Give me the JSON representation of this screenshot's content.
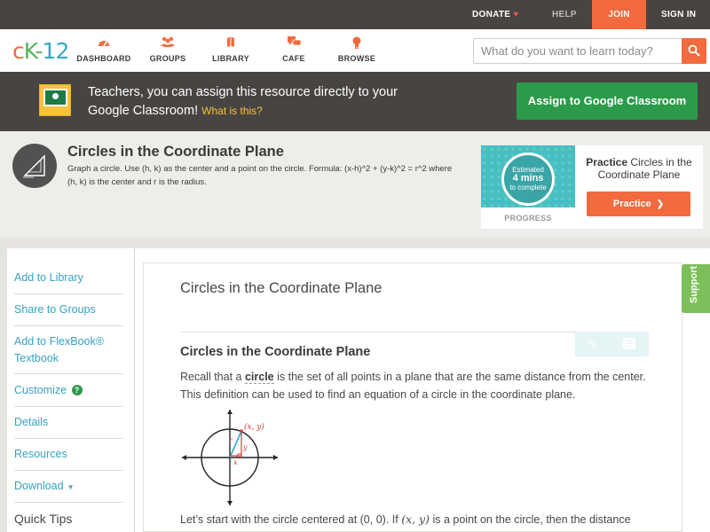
{
  "topbar": {
    "donate": "DONATE",
    "help": "HELP",
    "join": "JOIN",
    "signin": "SIGN IN"
  },
  "nav": {
    "logo": {
      "c": "c",
      "k": "K-",
      "n": "12"
    },
    "items": [
      {
        "label": "DASHBOARD",
        "icon": "dashboard-icon"
      },
      {
        "label": "GROUPS",
        "icon": "groups-icon"
      },
      {
        "label": "LIBRARY",
        "icon": "library-icon"
      },
      {
        "label": "CAFE",
        "icon": "cafe-icon"
      },
      {
        "label": "BROWSE",
        "icon": "browse-icon"
      }
    ],
    "search_placeholder": "What do you want to learn today?"
  },
  "classroom": {
    "text": "Teachers, you can assign this resource directly to your Google Classroom!",
    "what": "What is this?",
    "button": "Assign to Google Classroom"
  },
  "concept": {
    "title": "Circles in the Coordinate Plane",
    "description": "Graph a circle. Use (h, k) as the center and a point on the circle. Formula: (x-h)^2 + (y-k)^2 = r^2 where (h, k) is the center and r is the radius."
  },
  "practice": {
    "estimated": "Estimated",
    "mins": "4 mins",
    "to_complete": "to complete",
    "progress": "PROGRESS",
    "heading_bold": "Practice",
    "heading_rest": "Circles in the Coordinate Plane",
    "button": "Practice"
  },
  "sidebar": {
    "items": [
      {
        "label": "Add to Library"
      },
      {
        "label": "Share to Groups"
      },
      {
        "label": "Add to FlexBook® Textbook"
      },
      {
        "label": "Customize"
      },
      {
        "label": "Details"
      },
      {
        "label": "Resources"
      },
      {
        "label": "Download"
      }
    ],
    "quick_tips": "Quick Tips"
  },
  "content": {
    "title": "Circles in the Coordinate Plane",
    "heading": "Circles in the Coordinate Plane",
    "para1_before": "Recall that a ",
    "para1_keyword": "circle",
    "para1_after": " is the set of all points in a plane that are the same distance from the center. This definition can be used to find an equation of a circle in the coordinate plane.",
    "graph_point_label": "(x, y)",
    "graph_r": "r",
    "graph_x": "x",
    "graph_y": "y",
    "para2_before": "Let’s start with the circle centered at (0, 0). If ",
    "para2_math": "(x, y)",
    "para2_after": " is a point on the circle, then the distance"
  },
  "support": "Support",
  "colors": {
    "brand_orange": "#f26a3e",
    "brand_green": "#2c9a4a",
    "link_blue": "#3aa0c0",
    "dark_bar": "#474442"
  }
}
